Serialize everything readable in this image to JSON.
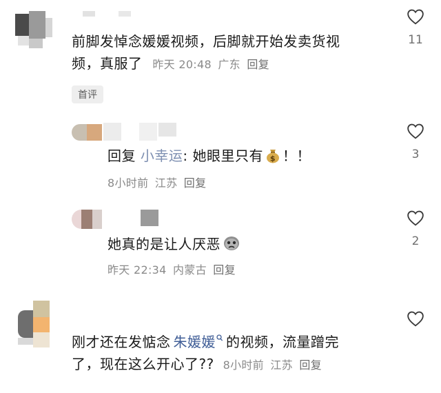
{
  "comments": [
    {
      "text_line1": "前脚发悼念媛媛视频，后脚就开始发卖货视",
      "text_line2": "频，真服了",
      "time": "昨天 20:48",
      "location": "广东",
      "reply_label": "回复",
      "badge": "首评",
      "likes": "11"
    },
    {
      "reply_prefix": "回复",
      "reply_to": "小幸运",
      "text": ": 她眼里只有",
      "text_suffix": "！！",
      "emoji_icon": "money-bag-icon",
      "time": "8小时前",
      "location": "江苏",
      "reply_label": "回复",
      "likes": "3"
    },
    {
      "text": "她真的是让人厌恶",
      "emoji_icon": "sad-face-icon",
      "time": "昨天 22:34",
      "location": "内蒙古",
      "reply_label": "回复",
      "likes": "2"
    },
    {
      "text_prefix": "刚才还在发惦念",
      "mention": "朱媛媛",
      "text_line1_rest": "的视频，流量蹭完",
      "text_line2": "了，现在这么开心了??",
      "time": "8小时前",
      "location": "江苏",
      "reply_label": "回复",
      "likes": ""
    }
  ],
  "colors": {
    "link": "#7d8fb1",
    "meta": "#8a8a8a",
    "badge_bg": "#eeeeee"
  }
}
